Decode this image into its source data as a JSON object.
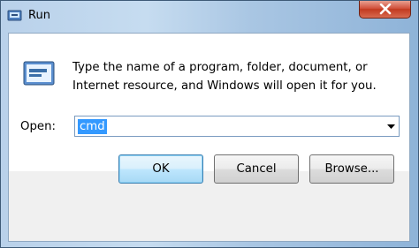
{
  "window": {
    "title": "Run",
    "title_icon": "run-icon",
    "close_icon": "close-icon"
  },
  "dialog": {
    "icon": "run-program-icon",
    "description": "Type the name of a program, folder, document, or Internet resource, and Windows will open it for you.",
    "open_label": "Open:",
    "open_value": "cmd"
  },
  "buttons": {
    "ok": "OK",
    "cancel": "Cancel",
    "browse": "Browse..."
  },
  "colors": {
    "selection": "#3399ff",
    "close_button": "#c23a20",
    "default_button_border": "#3c7fb1"
  }
}
